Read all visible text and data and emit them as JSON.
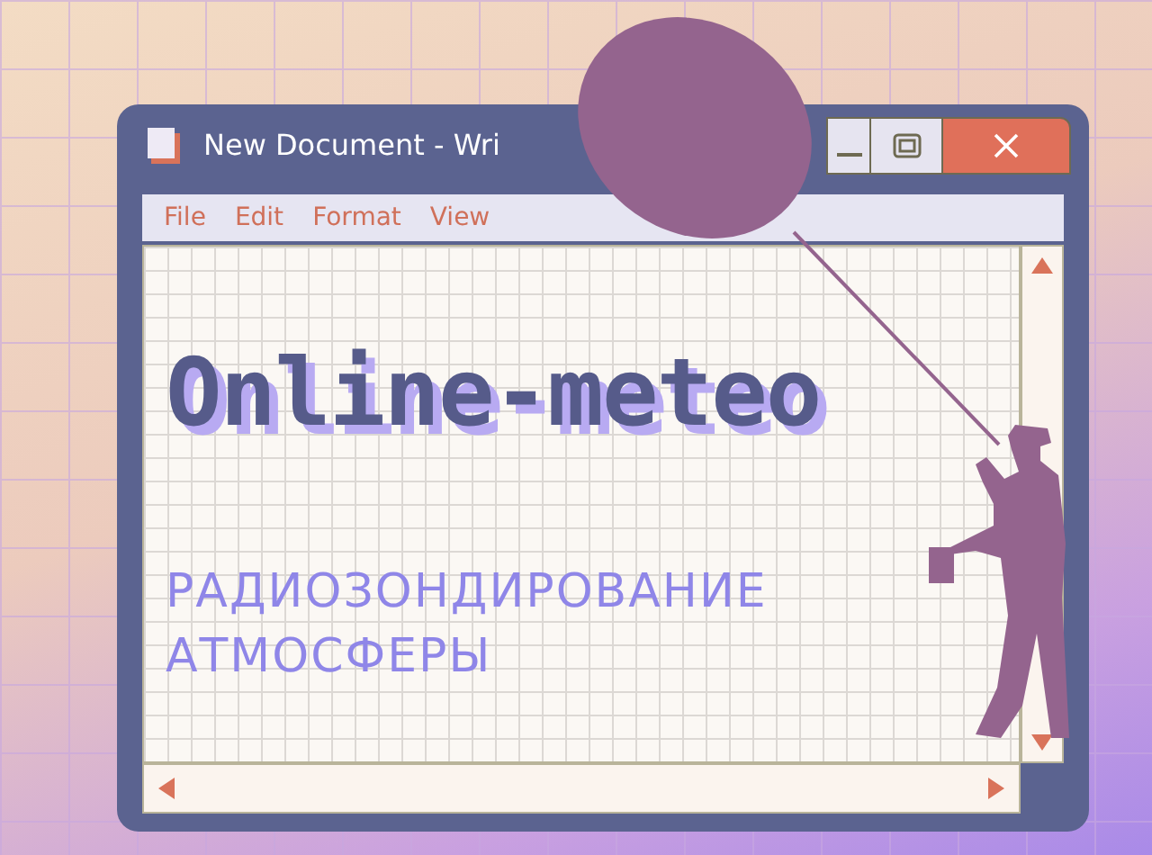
{
  "window": {
    "title": "New Document - Wri"
  },
  "menu": [
    {
      "label": "File"
    },
    {
      "label": "Edit"
    },
    {
      "label": "Format"
    },
    {
      "label": "View"
    }
  ],
  "document": {
    "headline": "Online-meteo",
    "subtitle_lines": [
      "РАДИОЗОНДИРОВАНИЕ",
      "АТМОСФЕРЫ"
    ]
  }
}
